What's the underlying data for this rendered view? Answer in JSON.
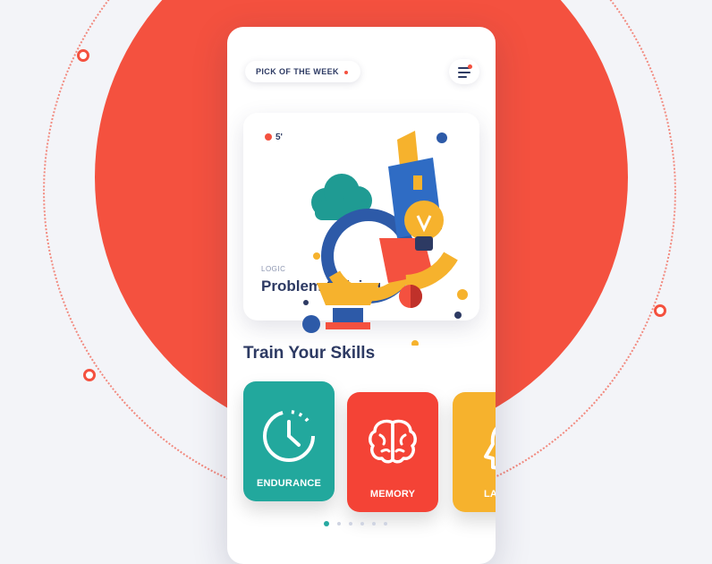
{
  "header": {
    "pick_label": "PICK OF THE WEEK"
  },
  "featured": {
    "time": "5'",
    "category": "LOGIC",
    "title": "Problem Solving"
  },
  "section": {
    "title": "Train Your Skills"
  },
  "skills": [
    {
      "label": "ENDURANCE",
      "color": "#22a89d",
      "icon": "stopwatch-icon"
    },
    {
      "label": "MEMORY",
      "color": "#f44336",
      "icon": "brain-icon"
    },
    {
      "label": "LANG",
      "color": "#f6b22d",
      "icon": "head-profile-icon"
    }
  ],
  "pagination": {
    "total": 6,
    "active": 1
  },
  "colors": {
    "accent": "#f4513f",
    "text_primary": "#2d3a63",
    "teal": "#22a89d",
    "yellow": "#f6b22d"
  }
}
